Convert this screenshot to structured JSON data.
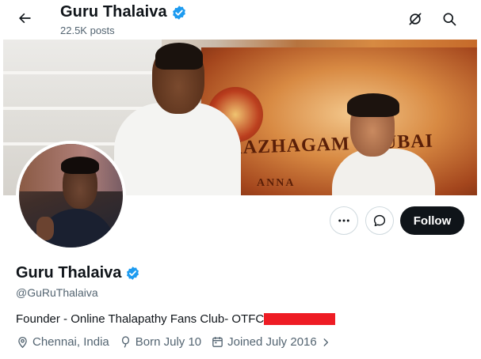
{
  "header": {
    "name": "Guru Thalaiva",
    "posts_count": "22.5K posts",
    "back_icon": "arrow-left-icon",
    "verified_icon": "verified-badge-icon",
    "grok_icon": "grok-slash-icon",
    "search_icon": "search-icon"
  },
  "banner": {
    "text_main": "KAZHAGAM - DUBAI",
    "text_sub": "ANNA"
  },
  "actions": {
    "more_icon": "more-horizontal-icon",
    "message_icon": "message-bubble-icon",
    "follow_label": "Follow"
  },
  "profile": {
    "display_name": "Guru Thalaiva",
    "handle": "@GuRuThalaiva",
    "bio": "Founder - Online Thalapathy Fans Club- OTFC",
    "location": "Chennai, India",
    "birthday": "Born July 10",
    "joined": "Joined July 2016"
  },
  "colors": {
    "verified_blue": "#1d9bf0",
    "follow_bg": "#0f1419",
    "secondary_text": "#536471",
    "redaction": "#ee1c24"
  }
}
